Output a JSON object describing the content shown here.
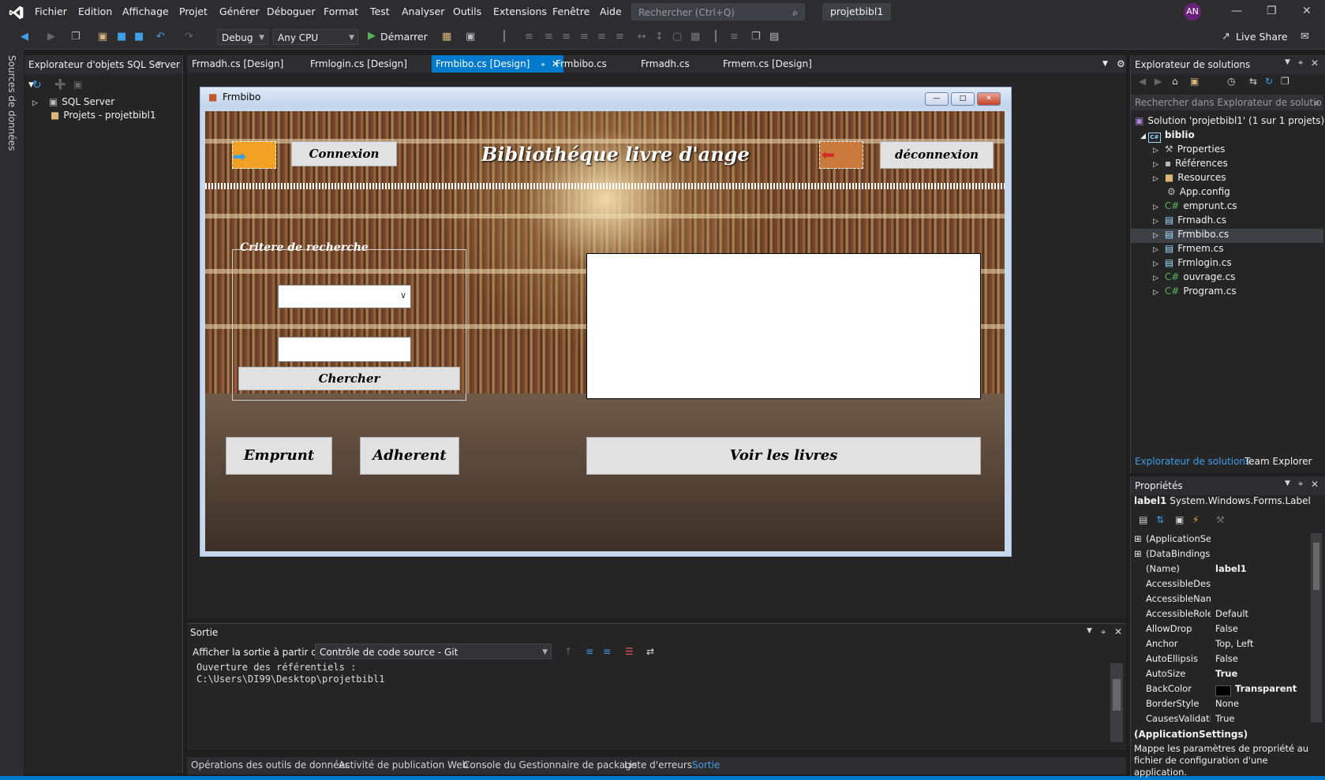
{
  "menu": [
    "Fichier",
    "Edition",
    "Affichage",
    "Projet",
    "Générer",
    "Déboguer",
    "Format",
    "Test",
    "Analyser",
    "Outils",
    "Extensions",
    "Fenêtre",
    "Aide"
  ],
  "search": {
    "placeholder": "Rechercher (Ctrl+Q)"
  },
  "project_name": "projetbibl1",
  "avatar_initials": "AN",
  "live_share": "Live Share",
  "toolbar": {
    "config": "Debug",
    "platform": "Any CPU",
    "start": "Démarrer"
  },
  "left_strip": "Sources de données",
  "sql_panel": {
    "title": "Explorateur d'objets SQL Server",
    "items": [
      "SQL Server",
      "Projets - projetbibl1"
    ]
  },
  "tabs": [
    "Frmadh.cs [Design]",
    "Frmlogin.cs [Design]",
    "Frmbibo.cs [Design]",
    "Frmbibo.cs",
    "Frmadh.cs",
    "Frmem.cs [Design]"
  ],
  "form": {
    "title": "Frmbibo",
    "connexion": "Connexion",
    "heading": "Bibliothéque livre d'ange",
    "deconnexion": "déconnexion",
    "group_legend": "Critere de recherche",
    "search_btn": "Chercher",
    "emprunt": "Emprunt",
    "adherent": "Adherent",
    "voir_livres": "Voir les livres"
  },
  "output": {
    "title": "Sortie",
    "show_from_label": "Afficher la sortie à partir de :",
    "source": "Contrôle de code source - Git",
    "lines": [
      "Ouverture des référentiels :",
      "C:\\Users\\DI99\\Desktop\\projetbibl1"
    ]
  },
  "bottom_tabs": [
    "Opérations des outils de données",
    "Activité de publication Web",
    "Console du Gestionnaire de package",
    "Liste d'erreurs",
    "Sortie"
  ],
  "solution": {
    "title": "Explorateur de solutions",
    "search_placeholder": "Rechercher dans Explorateur de solutio",
    "root": "Solution 'projetbibl1' (1 sur 1 projets)",
    "project": "biblio",
    "items": [
      "Properties",
      "Références",
      "Resources",
      "App.config",
      "emprunt.cs",
      "Frmadh.cs",
      "Frmbibo.cs",
      "Frmem.cs",
      "Frmlogin.cs",
      "ouvrage.cs",
      "Program.cs"
    ],
    "footer_tabs": [
      "Explorateur de solutions",
      "Team Explorer"
    ]
  },
  "properties": {
    "title": "Propriétés",
    "object_name": "label1",
    "object_type": "System.Windows.Forms.Label",
    "rows": [
      {
        "k": "(ApplicationSetti",
        "v": ""
      },
      {
        "k": "(DataBindings)",
        "v": ""
      },
      {
        "k": "(Name)",
        "v": "label1"
      },
      {
        "k": "AccessibleDescr",
        "v": ""
      },
      {
        "k": "AccessibleName",
        "v": ""
      },
      {
        "k": "AccessibleRole",
        "v": "Default"
      },
      {
        "k": "AllowDrop",
        "v": "False"
      },
      {
        "k": "Anchor",
        "v": "Top, Left"
      },
      {
        "k": "AutoEllipsis",
        "v": "False"
      },
      {
        "k": "AutoSize",
        "v": "True"
      },
      {
        "k": "BackColor",
        "v": "Transparent"
      },
      {
        "k": "BorderStyle",
        "v": "None"
      },
      {
        "k": "CausesValidatio",
        "v": "True"
      }
    ],
    "desc_title": "(ApplicationSettings)",
    "desc_text": "Mappe les paramètres de propriété au fichier de configuration d'une application."
  },
  "colors": {
    "accent": "#007acc",
    "bg": "#1e1e1e",
    "panel": "#252526"
  }
}
